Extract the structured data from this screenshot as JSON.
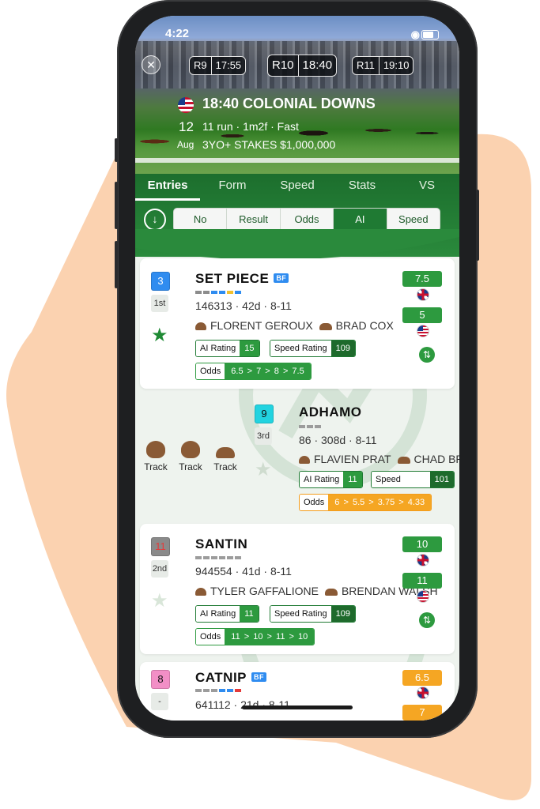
{
  "status_bar": {
    "time": "4:22"
  },
  "races": [
    {
      "id": "R9",
      "time": "17:55"
    },
    {
      "id": "R10",
      "time": "18:40"
    },
    {
      "id": "R11",
      "time": "19:10"
    }
  ],
  "race": {
    "title": "18:40 COLONIAL DOWNS",
    "day": "12",
    "month": "Aug",
    "meta": "11 run · 1m2f · Fast",
    "stakes": "3YO+ STAKES $1,000,000"
  },
  "tabs": [
    "Entries",
    "Form",
    "Speed",
    "Stats",
    "VS"
  ],
  "active_tab": "Entries",
  "segments": [
    "No",
    "Result",
    "Odds",
    "AI",
    "Speed"
  ],
  "active_segment": "AI",
  "labels": {
    "ai_rating": "AI Rating",
    "speed_rating": "Speed Rating",
    "odds": "Odds",
    "track": "Track",
    "bf": "BF"
  },
  "runners": [
    {
      "number": "3",
      "number_color": "#2f8cf0",
      "place": "1st",
      "name": "SET PIECE",
      "bf": true,
      "form": "146313 · 42d · 8-11",
      "jockey": "FLORENT GEROUX",
      "trainer": "BRAD COX",
      "ai_rating": "15",
      "speed_rating": "109",
      "odds": "6.5 > 7 > 8 > 7.5",
      "price_uk": "7.5",
      "price_us": "5",
      "star": "filled"
    },
    {
      "number": "9",
      "number_color": "#22d3e0",
      "place": "3rd",
      "name": "ADHAMO",
      "bf": false,
      "form": "86 · 308d · 8-11",
      "jockey": "FLAVIEN PRAT",
      "trainer": "CHAD BROWN",
      "ai_rating": "11",
      "speed_rating": "101",
      "odds": "6 > 5.5 > 3.75 > 4.33",
      "star": "outline"
    },
    {
      "number": "11",
      "number_color": "#8a8a8a",
      "place": "2nd",
      "name": "SANTIN",
      "bf": false,
      "form": "944554 · 41d · 8-11",
      "jockey": "TYLER GAFFALIONE",
      "trainer": "BRENDAN WALSH",
      "ai_rating": "11",
      "speed_rating": "109",
      "odds": "11 > 10 > 11 > 10",
      "price_uk": "10",
      "price_us": "11",
      "star": "outline"
    },
    {
      "number": "8",
      "number_color": "#f28fc6",
      "place": "-",
      "name": "CATNIP",
      "bf": true,
      "form": "641112 · 21d · 8-11",
      "price_uk": "6.5",
      "price_us": "7"
    }
  ],
  "icons": {
    "close": "close-icon",
    "download": "download-circle-icon",
    "star": "star-icon",
    "swap": "swap-arrows-icon",
    "jockey_cap": "jockey-cap-icon",
    "trainer_hat": "trainer-hat-icon"
  },
  "colors": {
    "brand_green": "#1f7a33",
    "accent_green": "#2d9a3f",
    "accent_orange": "#f5a623",
    "backdrop_peach": "#fbd2b0"
  }
}
